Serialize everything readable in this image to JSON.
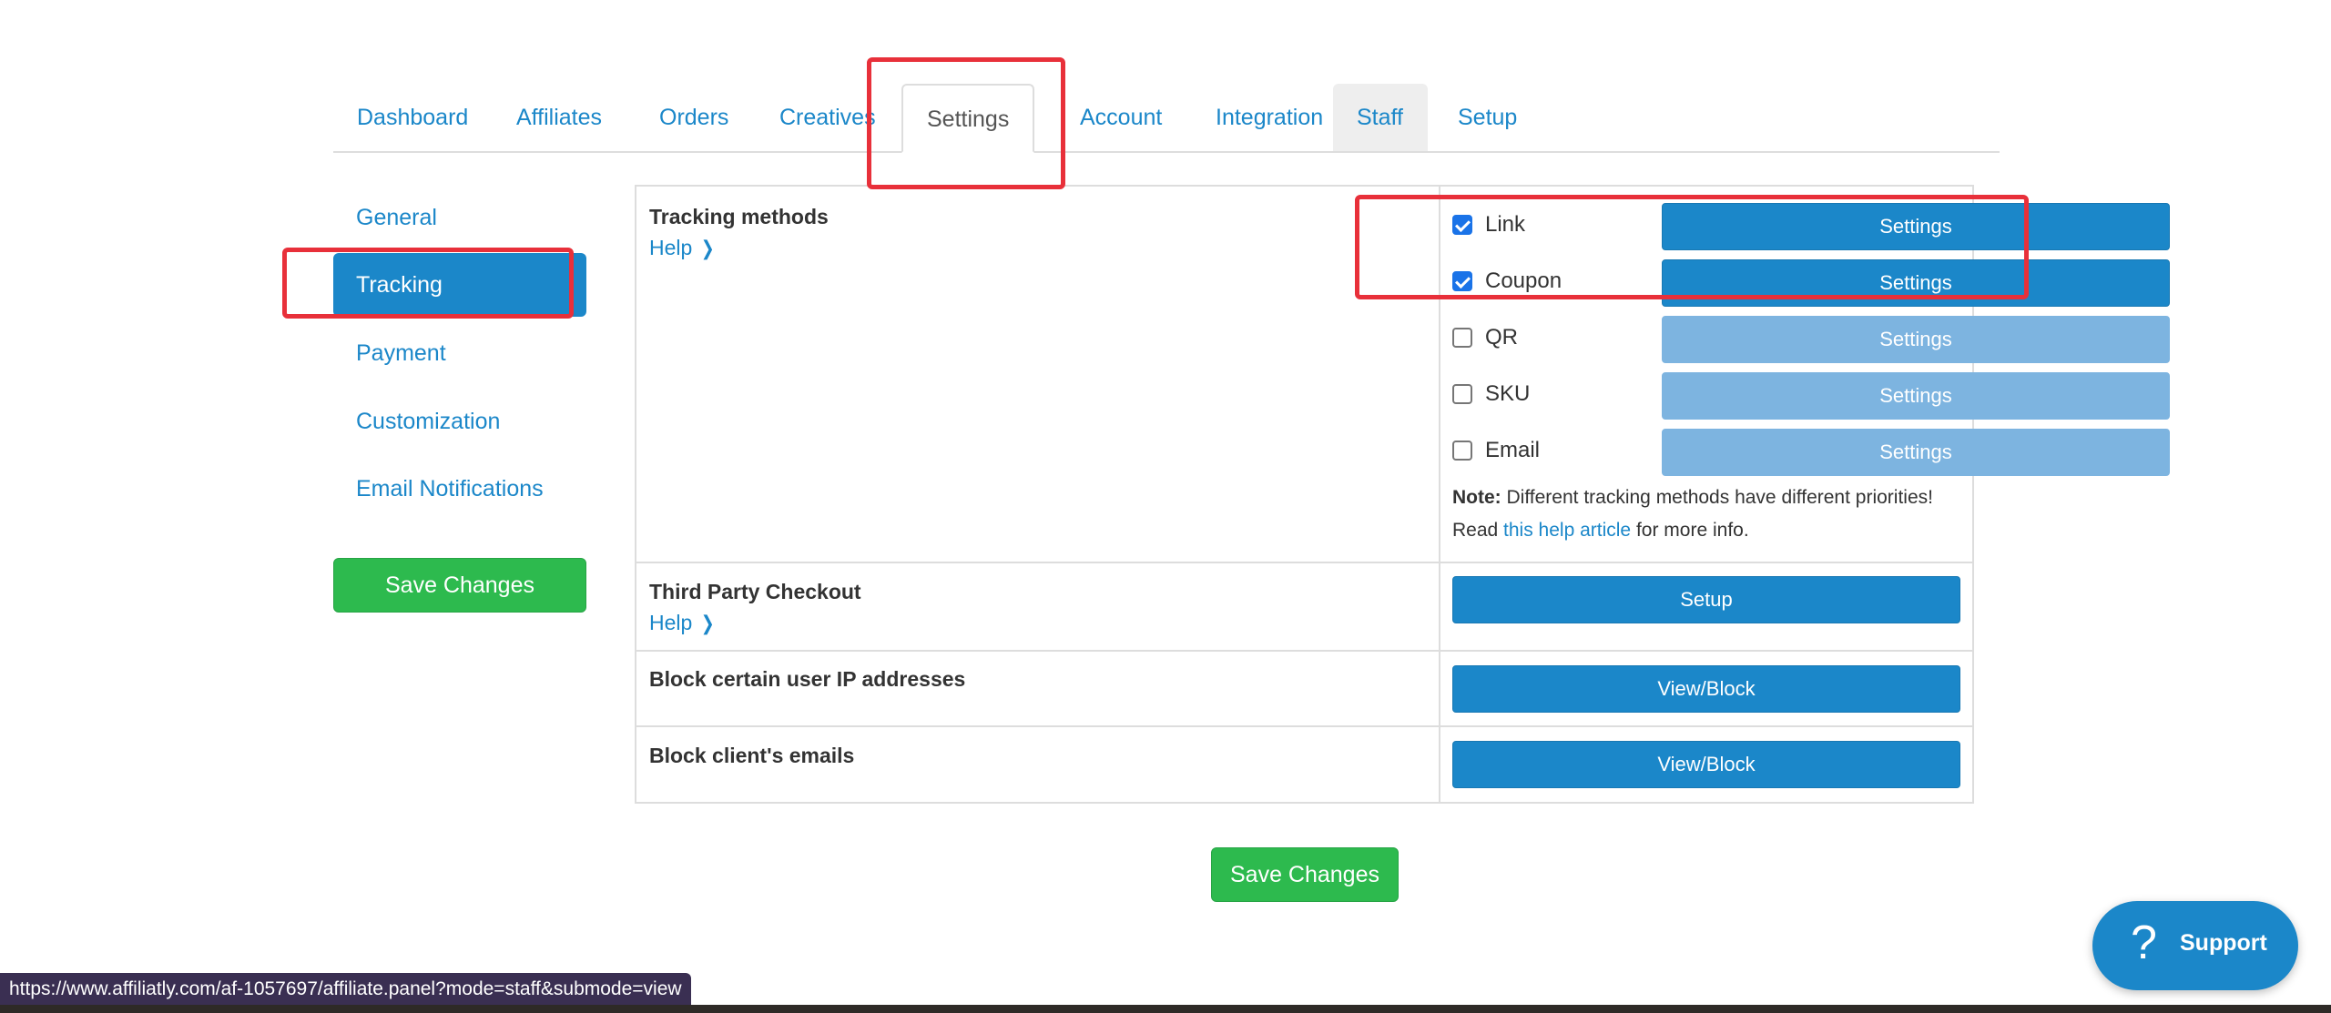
{
  "nav": {
    "tabs": [
      {
        "label": "Dashboard"
      },
      {
        "label": "Affiliates"
      },
      {
        "label": "Orders"
      },
      {
        "label": "Creatives"
      },
      {
        "label": "Settings",
        "active": true
      },
      {
        "label": "Account"
      },
      {
        "label": "Integration"
      },
      {
        "label": "Staff"
      },
      {
        "label": "Setup"
      }
    ]
  },
  "sidebar": {
    "items": [
      {
        "label": "General"
      },
      {
        "label": "Tracking",
        "active": true
      },
      {
        "label": "Payment"
      },
      {
        "label": "Customization"
      },
      {
        "label": "Email Notifications"
      }
    ],
    "save_label": "Save Changes"
  },
  "settings": {
    "tracking": {
      "title": "Tracking methods",
      "help": "Help",
      "methods": [
        {
          "label": "Link",
          "checked": true,
          "button": "Settings"
        },
        {
          "label": "Coupon",
          "checked": true,
          "button": "Settings"
        },
        {
          "label": "QR",
          "checked": false,
          "button": "Settings"
        },
        {
          "label": "SKU",
          "checked": false,
          "button": "Settings"
        },
        {
          "label": "Email",
          "checked": false,
          "button": "Settings"
        }
      ],
      "note_bold": "Note:",
      "note_text": " Different tracking methods have different priorities!",
      "note_read": "Read ",
      "note_link": "this help article",
      "note_tail": " for more info."
    },
    "third_party": {
      "title": "Third Party Checkout",
      "help": "Help",
      "button": "Setup"
    },
    "block_ip": {
      "title": "Block certain user IP addresses",
      "button": "View/Block"
    },
    "block_emails": {
      "title": "Block client's emails",
      "button": "View/Block"
    }
  },
  "save_bottom_label": "Save Changes",
  "support": {
    "label": "Support",
    "icon": "question-mark-icon"
  },
  "status_url": "https://www.affiliatly.com/af-1057697/affiliate.panel?mode=staff&submode=view",
  "colors": {
    "primary": "#1b87c9",
    "success": "#2dba4e",
    "highlight": "#e8303a",
    "disabled": "#7db4e0"
  }
}
